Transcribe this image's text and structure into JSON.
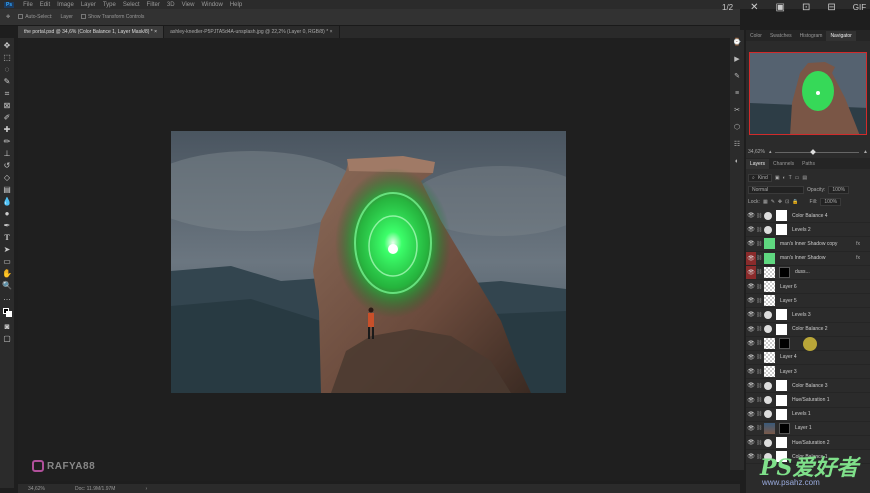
{
  "menu": {
    "app_icon": "Ps",
    "items": [
      "File",
      "Edit",
      "Image",
      "Layer",
      "Type",
      "Select",
      "Filter",
      "3D",
      "View",
      "Window",
      "Help"
    ]
  },
  "options_bar": {
    "auto_select_label": "Auto-Select:",
    "auto_select_value": "Layer",
    "transform_label": "Show Transform Controls"
  },
  "top_right": {
    "zoom_ratio": "1/2",
    "gif_label": "GIF"
  },
  "doc_tabs": [
    {
      "label": "the portal.psd @ 34,6% (Color Balance 1, Layer Mask/8) *",
      "close": "×"
    },
    {
      "label": "ashley-knedler-P5PJTA5d4A-unsplash.jpg @ 22,2% (Layer 0, RGB/8) *",
      "close": "×"
    }
  ],
  "status_bar": {
    "zoom": "34,62%",
    "doc": "Doc: 11.9M/1.97M",
    "arrow": "›"
  },
  "watermark": {
    "handle": "RAFYA88"
  },
  "panel_tabs_top": [
    "Color",
    "Swatches",
    "Histogram",
    "Navigator"
  ],
  "navigator": {
    "zoom": "34,62%"
  },
  "panel_tabs_layers": [
    "Layers",
    "Channels",
    "Paths"
  ],
  "layers_controls": {
    "filter_kind": "Kind",
    "blend_mode": "Normal",
    "opacity_label": "Opacity:",
    "opacity_value": "100%",
    "lock_label": "Lock:",
    "fill_label": "Fill:",
    "fill_value": "100%"
  },
  "layers": [
    {
      "name": "Color Balance 4",
      "thumb": "white",
      "adj": true,
      "eye": "normal"
    },
    {
      "name": "Levels 2",
      "thumb": "white",
      "adj": true,
      "eye": "normal"
    },
    {
      "name": "man's Inner Shadow copy",
      "thumb": "green",
      "adj": false,
      "eye": "normal",
      "fx": "fx"
    },
    {
      "name": "man's Inner Shadow",
      "thumb": "green",
      "adj": false,
      "eye": "red",
      "fx": "fx"
    },
    {
      "name": "duss...",
      "thumb": "check",
      "adj": false,
      "eye": "red",
      "mask": "black"
    },
    {
      "name": "Layer 6",
      "thumb": "check",
      "adj": false,
      "eye": "normal"
    },
    {
      "name": "Layer 5",
      "thumb": "check",
      "adj": false,
      "eye": "normal"
    },
    {
      "name": "Levels 3",
      "thumb": "white",
      "adj": true,
      "eye": "normal"
    },
    {
      "name": "Color Balance 2",
      "thumb": "white",
      "adj": true,
      "eye": "normal"
    },
    {
      "name": "",
      "thumb": "check",
      "adj": false,
      "eye": "normal",
      "mask": "black"
    },
    {
      "name": "Layer 4",
      "thumb": "check",
      "adj": false,
      "eye": "normal"
    },
    {
      "name": "Layer 3",
      "thumb": "check",
      "adj": false,
      "eye": "normal"
    },
    {
      "name": "Color Balance 3",
      "thumb": "white",
      "adj": true,
      "eye": "normal"
    },
    {
      "name": "Hue/Saturation 1",
      "thumb": "white",
      "adj": true,
      "eye": "normal"
    },
    {
      "name": "Levels 1",
      "thumb": "white",
      "adj": true,
      "eye": "normal"
    },
    {
      "name": "Layer 1",
      "thumb": "photo",
      "adj": false,
      "eye": "normal",
      "mask": "black"
    },
    {
      "name": "Hue/Saturation 2",
      "thumb": "white",
      "adj": true,
      "eye": "normal"
    },
    {
      "name": "Color Balance 1",
      "thumb": "white",
      "adj": true,
      "eye": "normal"
    }
  ],
  "brand": {
    "logo": "PS爱好者",
    "url": "www.psahz.com"
  },
  "colors": {
    "accent_red": "#d12b2b",
    "portal_green": "#3cff6a",
    "panel_bg": "#2b2b2b"
  }
}
